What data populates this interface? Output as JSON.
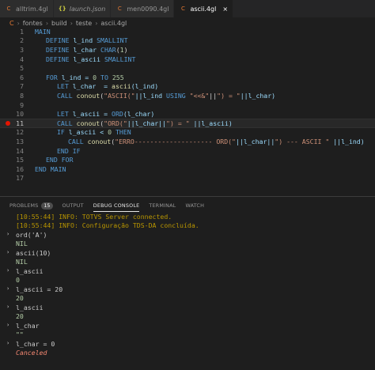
{
  "tabs": [
    {
      "label": "alltrim.4gl",
      "icon": "c-file-icon",
      "active": false,
      "italic": false
    },
    {
      "label": "launch.json",
      "icon": "json-file-icon",
      "active": false,
      "italic": true
    },
    {
      "label": "men0090.4gl",
      "icon": "c-file-icon",
      "active": false,
      "italic": false
    },
    {
      "label": "ascii.4gl",
      "icon": "c-file-icon",
      "active": true,
      "italic": false,
      "close": "×"
    }
  ],
  "breadcrumb": {
    "icon": "C",
    "items": [
      "fontes",
      "build",
      "teste",
      "ascii.4gl"
    ],
    "separator": "›"
  },
  "editor": {
    "line_numbers": [
      "1",
      "2",
      "3",
      "4",
      "5",
      "6",
      "7",
      "8",
      "9",
      "10",
      "11",
      "12",
      "13",
      "14",
      "15",
      "16",
      "17"
    ],
    "breakpoint_line": "11",
    "current_line": "11"
  },
  "panel": {
    "tabs": [
      "PROBLEMS",
      "OUTPUT",
      "DEBUG CONSOLE",
      "TERMINAL",
      "WATCH"
    ],
    "problems_count": "15",
    "active_tab": "DEBUG CONSOLE"
  },
  "console": {
    "lines": [
      {
        "kind": "info",
        "text": "[10:55:44] INFO: TOTVS Server connected."
      },
      {
        "kind": "info",
        "text": "[10:55:44] INFO: Configuração TDS-DA concluída."
      },
      {
        "kind": "inp",
        "text": "ord('A')"
      },
      {
        "kind": "res",
        "text": "NIL"
      },
      {
        "kind": "inp",
        "text": "ascii(10)"
      },
      {
        "kind": "res",
        "text": "NIL"
      },
      {
        "kind": "inp",
        "text": "l_ascii"
      },
      {
        "kind": "res",
        "text": "0"
      },
      {
        "kind": "inp",
        "text": "l_ascii = 20"
      },
      {
        "kind": "res",
        "text": "20"
      },
      {
        "kind": "inp",
        "text": "l_ascii"
      },
      {
        "kind": "res",
        "text": "20"
      },
      {
        "kind": "inp",
        "text": "l_char"
      },
      {
        "kind": "res",
        "text": "\"\""
      },
      {
        "kind": "inp",
        "text": "l_char = 0"
      },
      {
        "kind": "cancel",
        "text": "Canceled"
      }
    ],
    "chevrons": [
      "›",
      "›",
      "›",
      "›",
      "›",
      "›",
      "›",
      "›"
    ]
  },
  "colors": {
    "background": "#1e1e1e",
    "keyword": "#569cd6",
    "function": "#dcdcaa",
    "string": "#ce9178",
    "number": "#b5cea8",
    "breakpoint": "#e51400",
    "info": "#b89500",
    "cancel": "#f48771"
  },
  "code": {
    "l1": [
      "MAIN"
    ],
    "l2": [
      "DEFINE",
      " l_ind ",
      "SMALLINT"
    ],
    "l3": [
      "DEFINE",
      " l_char ",
      "CHAR",
      "(",
      "1",
      ")"
    ],
    "l4": [
      "DEFINE",
      " l_ascii ",
      "SMALLINT"
    ],
    "l6": [
      "FOR",
      " l_ind = ",
      "0",
      " ",
      "TO",
      " ",
      "255"
    ],
    "l7": [
      "LET",
      " l_char  = ",
      "ascii",
      "(l_ind)"
    ],
    "l8": [
      "CALL",
      " ",
      "conout",
      "(",
      "\"ASCII(\"",
      "||l_ind ",
      "USING",
      " ",
      "\"<<&\"",
      "||",
      "\") = \"",
      "||l_char)"
    ],
    "l10": [
      "LET",
      " l_ascii = ",
      "ORD",
      "(l_char)"
    ],
    "l11": [
      "CALL",
      " ",
      "conout",
      "(",
      "\"ORD(\"",
      "||l_char||",
      "\") = \"",
      " ||l_ascii)"
    ],
    "l12": [
      "IF",
      " l_ascii < ",
      "0",
      " ",
      "THEN"
    ],
    "l13": [
      "CALL",
      " ",
      "conout",
      "(",
      "\"ERRO-------------------- ORD(\"",
      "||l_char||",
      "\") --- ASCII \"",
      " ||l_ind)"
    ],
    "l14": [
      "END IF"
    ],
    "l15": [
      "END FOR"
    ],
    "l16": [
      "END MAIN"
    ]
  }
}
